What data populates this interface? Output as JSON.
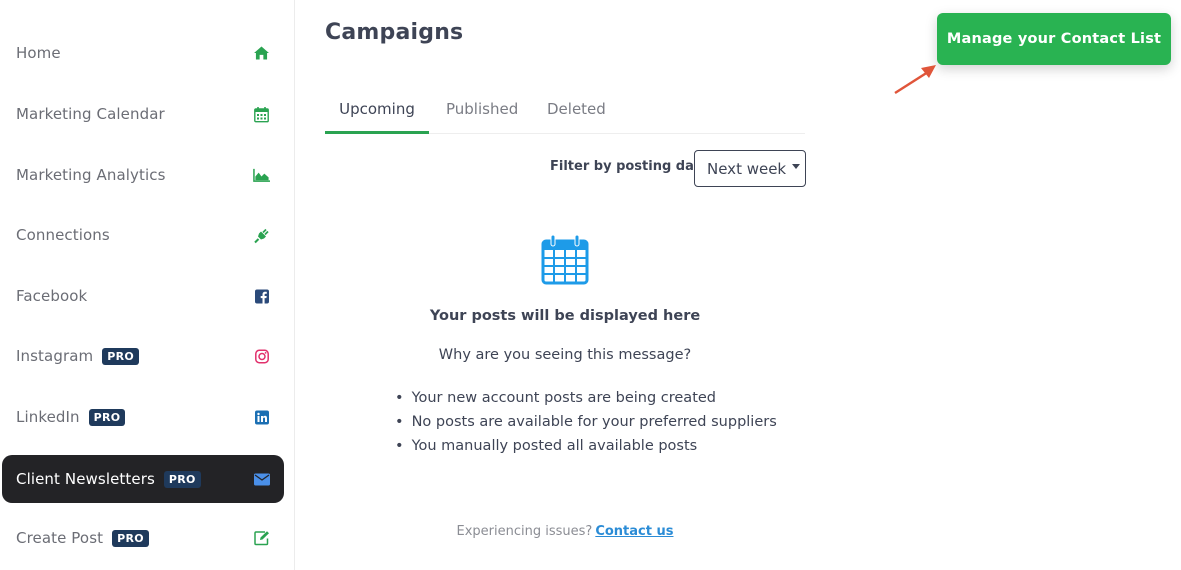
{
  "sidebar": {
    "items": [
      {
        "label": "Home",
        "icon": "home-icon",
        "pro": false
      },
      {
        "label": "Marketing Calendar",
        "icon": "calendar-icon",
        "pro": false
      },
      {
        "label": "Marketing Analytics",
        "icon": "area-chart-icon",
        "pro": false
      },
      {
        "label": "Connections",
        "icon": "plug-icon",
        "pro": false
      },
      {
        "label": "Facebook",
        "icon": "facebook-icon",
        "pro": false
      },
      {
        "label": "Instagram",
        "icon": "instagram-icon",
        "pro": true
      },
      {
        "label": "LinkedIn",
        "icon": "linkedin-icon",
        "pro": true
      },
      {
        "label": "Client Newsletters",
        "icon": "envelope-icon",
        "pro": true,
        "active": true
      },
      {
        "label": "Create Post",
        "icon": "edit-icon",
        "pro": true
      }
    ],
    "pro_label": "PRO"
  },
  "main": {
    "title": "Campaigns",
    "tabs": [
      {
        "label": "Upcoming",
        "active": true
      },
      {
        "label": "Published",
        "active": false
      },
      {
        "label": "Deleted",
        "active": false
      }
    ],
    "filter": {
      "label": "Filter by posting date:",
      "value": "Next week"
    },
    "empty_state": {
      "title": "Your posts will be displayed here",
      "why": "Why are you seeing this message?",
      "reasons": [
        "Your new account posts are being created",
        "No posts are available for your preferred suppliers",
        "You manually posted all available posts"
      ]
    },
    "footer": {
      "text": "Experiencing issues?",
      "link": "Contact us"
    },
    "cta": "Manage your Contact List"
  },
  "colors": {
    "accent_green": "#29b352",
    "sidebar_active": "#232326",
    "pro_badge": "#1f3a5c",
    "link_blue": "#2b8cd6",
    "arrow_red": "#e0553a"
  }
}
